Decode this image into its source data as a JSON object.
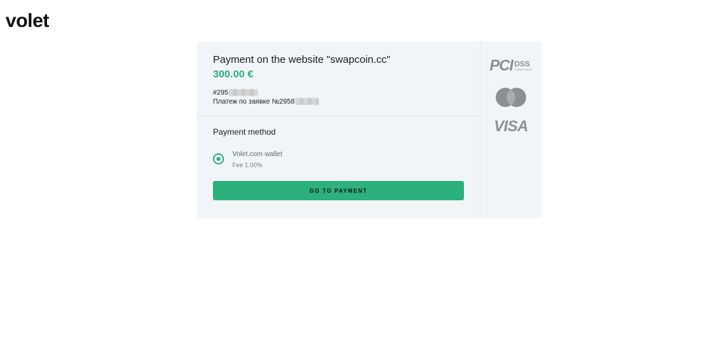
{
  "brand": {
    "logo_text": "volet"
  },
  "payment": {
    "title": "Payment on the website \"swapcoin.cc\"",
    "amount": "300.00 €",
    "order_id_prefix": "#295",
    "order_description_prefix": "Платеж по заявке №2958"
  },
  "method_section": {
    "title": "Payment method",
    "selected": {
      "name": "Volet.com wallet",
      "fee": "Fee 1.00%"
    },
    "button_label": "GO TO PAYMENT"
  },
  "badges": {
    "pci_mark": "PCI",
    "pci_dss": "DSS",
    "pci_compliant": "COMPLIANT",
    "visa": "VISA",
    "mastercard_icon": "mastercard-icon"
  },
  "colors": {
    "accent": "#2cb07d",
    "card_bg": "#f2f5f8",
    "badge_gray": "#8d8f93"
  }
}
